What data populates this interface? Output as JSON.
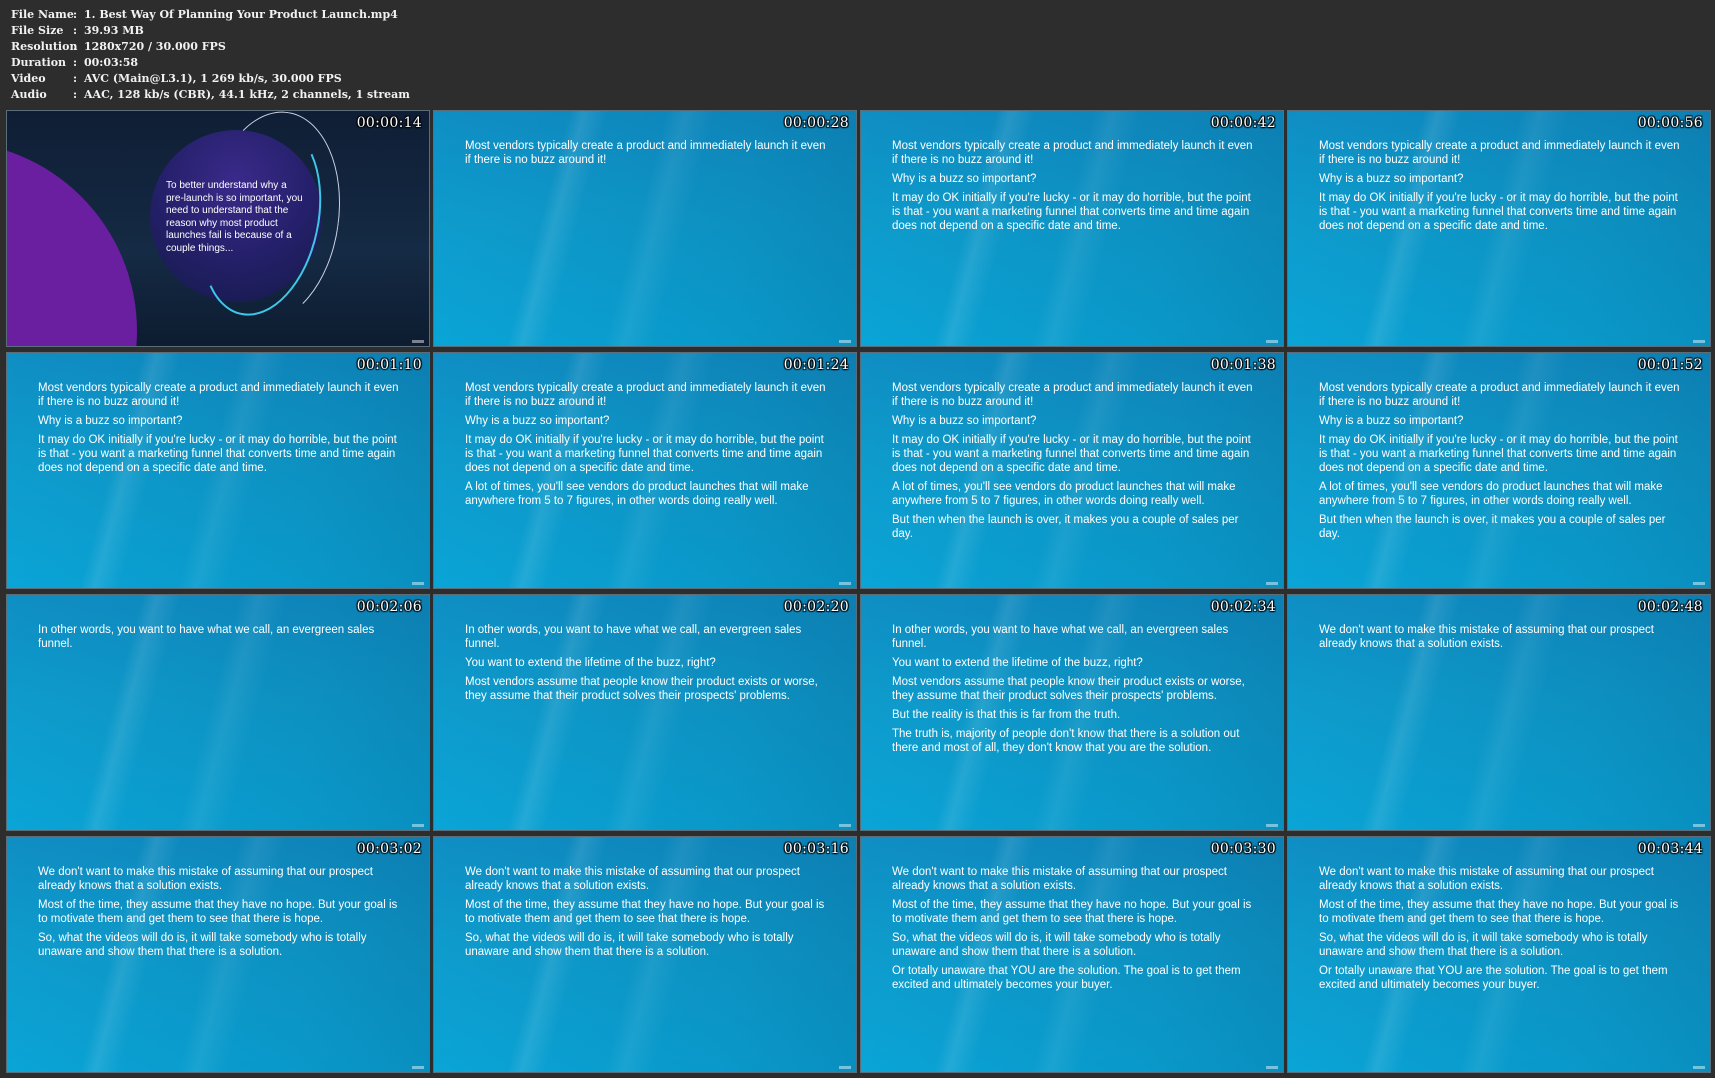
{
  "file_info": [
    {
      "label": "File Name",
      "value": "1. Best Way Of Planning Your Product Launch.mp4"
    },
    {
      "label": "File Size",
      "value": "39.93 MB"
    },
    {
      "label": "Resolution",
      "value": "1280x720 / 30.000 FPS"
    },
    {
      "label": "Duration",
      "value": "00:03:58"
    },
    {
      "label": "Video",
      "value": "AVC (Main@L3.1), 1 269 kb/s, 30.000 FPS"
    },
    {
      "label": "Audio",
      "value": "AAC, 128 kb/s (CBR), 44.1 kHz, 2 channels, 1 stream"
    }
  ],
  "thumbnails": [
    {
      "timestamp": "00:00:14",
      "style": "dark",
      "paragraphs": [
        "To better understand why a pre-launch is so important, you need to understand that the reason why most product launches fail is because of a couple things..."
      ]
    },
    {
      "timestamp": "00:00:28",
      "paragraphs": [
        "Most vendors typically create a product and immediately launch it even if there is no buzz around it!"
      ]
    },
    {
      "timestamp": "00:00:42",
      "paragraphs": [
        "Most vendors typically create a product and immediately launch it even if there is no buzz around it!",
        "Why is a buzz so important?",
        "It may do OK initially if you're lucky - or it may do horrible, but the point is that - you want a marketing funnel that converts time and time again does not depend on a specific date and time."
      ]
    },
    {
      "timestamp": "00:00:56",
      "paragraphs": [
        "Most vendors typically create a product and immediately launch it even if there is no buzz around it!",
        "Why is a buzz so important?",
        "It may do OK initially if you're lucky - or it may do horrible, but the point is that - you want a marketing funnel that converts time and time again does not depend on a specific date and time."
      ]
    },
    {
      "timestamp": "00:01:10",
      "paragraphs": [
        "Most vendors typically create a product and immediately launch it even if there is no buzz around it!",
        "Why is a buzz so important?",
        "It may do OK initially if you're lucky - or it may do horrible, but the point is that - you want a marketing funnel that converts time and time again does not depend on a specific date and time."
      ]
    },
    {
      "timestamp": "00:01:24",
      "paragraphs": [
        "Most vendors typically create a product and immediately launch it even if there is no buzz around it!",
        "Why is a buzz so important?",
        "It may do OK initially if you're lucky - or it may do horrible, but the point is that - you want a marketing funnel that converts time and time again does not depend on a specific date and time.",
        "A lot of times, you'll see vendors do product launches that will make anywhere from 5 to 7 figures, in other words doing really well."
      ]
    },
    {
      "timestamp": "00:01:38",
      "paragraphs": [
        "Most vendors typically create a product and immediately launch it even if there is no buzz around it!",
        "Why is a buzz so important?",
        "It may do OK initially if you're lucky - or it may do horrible, but the point is that - you want a marketing funnel that converts time and time again does not depend on a specific date and time.",
        "A lot of times, you'll see vendors do product launches that will make anywhere from 5 to 7 figures, in other words doing really well.",
        "But then when the launch is over, it makes you a couple of sales per day."
      ]
    },
    {
      "timestamp": "00:01:52",
      "paragraphs": [
        "Most vendors typically create a product and immediately launch it even if there is no buzz around it!",
        "Why is a buzz so important?",
        "It may do OK initially if you're lucky - or it may do horrible, but the point is that - you want a marketing funnel that converts time and time again does not depend on a specific date and time.",
        "A lot of times, you'll see vendors do product launches that will make anywhere from 5 to 7 figures, in other words doing really well.",
        "But then when the launch is over, it makes you a couple of sales per day."
      ]
    },
    {
      "timestamp": "00:02:06",
      "paragraphs": [
        "In other words, you want to have what we call, an evergreen sales funnel."
      ]
    },
    {
      "timestamp": "00:02:20",
      "paragraphs": [
        "In other words, you want to have what we call, an evergreen sales funnel.",
        "You want to extend the lifetime of the buzz, right?",
        "Most vendors assume that people know their product exists or worse, they assume that their product solves their prospects' problems."
      ]
    },
    {
      "timestamp": "00:02:34",
      "paragraphs": [
        "In other words, you want to have what we call, an evergreen sales funnel.",
        "You want to extend the lifetime of the buzz, right?",
        "Most vendors assume that people know their product exists or worse, they assume that their product solves their prospects' problems.",
        "But the reality is that this is far from the truth.",
        "The truth is, majority of people don't know that there is a solution out there and most of all, they don't know that you are the solution."
      ]
    },
    {
      "timestamp": "00:02:48",
      "paragraphs": [
        "We don't want to make this mistake of assuming that our prospect already knows that a solution exists."
      ]
    },
    {
      "timestamp": "00:03:02",
      "paragraphs": [
        "We don't want to make this mistake of assuming that our prospect already knows that a solution exists.",
        "Most of the time, they assume that they have no hope. But your goal is to motivate them and get them to see that there is hope.",
        "So, what the videos will do is, it will take somebody who is totally unaware and show them that there is a solution."
      ]
    },
    {
      "timestamp": "00:03:16",
      "paragraphs": [
        "We don't want to make this mistake of assuming that our prospect already knows that a solution exists.",
        "Most of the time, they assume that they have no hope. But your goal is to motivate them and get them to see that there is hope.",
        "So, what the videos will do is, it will take somebody who is totally unaware and show them that there is a solution."
      ]
    },
    {
      "timestamp": "00:03:30",
      "paragraphs": [
        "We don't want to make this mistake of assuming that our prospect already knows that a solution exists.",
        "Most of the time, they assume that they have no hope. But your goal is to motivate them and get them to see that there is hope.",
        "So, what the videos will do is, it will take somebody who is totally unaware and show them that there is a solution.",
        "Or totally unaware that YOU are the solution. The goal is to get them excited and ultimately becomes your buyer."
      ]
    },
    {
      "timestamp": "00:03:44",
      "paragraphs": [
        "We don't want to make this mistake of assuming that our prospect already knows that a solution exists.",
        "Most of the time, they assume that they have no hope. But your goal is to motivate them and get them to see that there is hope.",
        "So, what the videos will do is, it will take somebody who is totally unaware and show them that there is a solution.",
        "Or totally unaware that YOU are the solution. The goal is to get them excited and ultimately becomes your buyer."
      ]
    }
  ]
}
